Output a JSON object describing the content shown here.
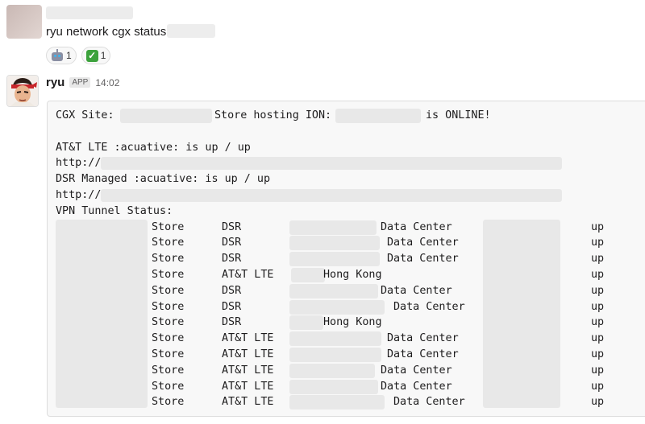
{
  "previous_message": {
    "text": "ryu network cgx status",
    "reactions": [
      {
        "icon": "robot-icon",
        "count": "1"
      },
      {
        "icon": "check-icon",
        "count": "1"
      }
    ]
  },
  "bot_message": {
    "name": "ryu",
    "badge": "APP",
    "time": "14:02",
    "site_line": {
      "prefix": "CGX Site:",
      "middle": "Store hosting ION:",
      "suffix": "is ONLINE!"
    },
    "att_status": "AT&T LTE :acuative:  is up / up",
    "att_url_prefix": "http://",
    "dsr_status": "DSR Managed :acuative:  is up / up",
    "dsr_url_prefix": "http://",
    "vpn_title": "VPN Tunnel Status:",
    "vpn_rows": [
      {
        "site": "Store",
        "circuit": "DSR",
        "dest": "Data Center",
        "status": "up"
      },
      {
        "site": "Store",
        "circuit": "DSR",
        "dest": "Data Center",
        "status": "up"
      },
      {
        "site": "Store",
        "circuit": "DSR",
        "dest": "Data Center",
        "status": "up"
      },
      {
        "site": "Store",
        "circuit": "AT&T LTE",
        "dest": "Hong Kong",
        "status": "up"
      },
      {
        "site": "Store",
        "circuit": "DSR",
        "dest": "Data Center",
        "status": "up"
      },
      {
        "site": "Store",
        "circuit": "DSR",
        "dest": "Data Center",
        "status": "up"
      },
      {
        "site": "Store",
        "circuit": "DSR",
        "dest": "Hong Kong",
        "status": "up"
      },
      {
        "site": "Store",
        "circuit": "AT&T LTE",
        "dest": "Data Center",
        "status": "up"
      },
      {
        "site": "Store",
        "circuit": "AT&T LTE",
        "dest": "Data Center",
        "status": "up"
      },
      {
        "site": "Store",
        "circuit": "AT&T LTE",
        "dest": "Data Center",
        "status": "up"
      },
      {
        "site": "Store",
        "circuit": "AT&T LTE",
        "dest": "Data Center",
        "status": "up"
      },
      {
        "site": "Store",
        "circuit": "AT&T LTE",
        "dest": "Data Center",
        "status": "up"
      }
    ]
  }
}
